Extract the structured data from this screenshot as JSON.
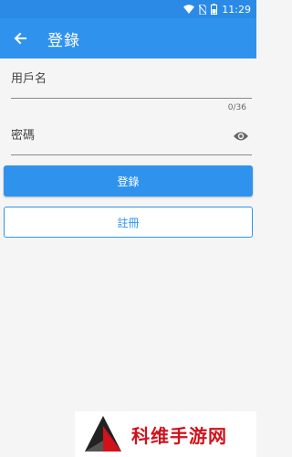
{
  "status_bar": {
    "time": "11:29",
    "icons": [
      "wifi-icon",
      "no-sim-icon",
      "battery-icon"
    ]
  },
  "app_bar": {
    "back_icon": "arrow-back-icon",
    "title": "登錄"
  },
  "form": {
    "username_placeholder": "用戶名",
    "password_placeholder": "密碼",
    "password_counter": "0/36",
    "visibility_icon": "eye-icon"
  },
  "buttons": {
    "login_label": "登錄",
    "register_label": "註冊"
  },
  "watermark": {
    "text": "科维手游网"
  },
  "colors": {
    "primary": "#2f93ee",
    "status_bar": "#2a8ae6",
    "background": "#f5f5f5",
    "watermark_red": "#d0121b"
  }
}
